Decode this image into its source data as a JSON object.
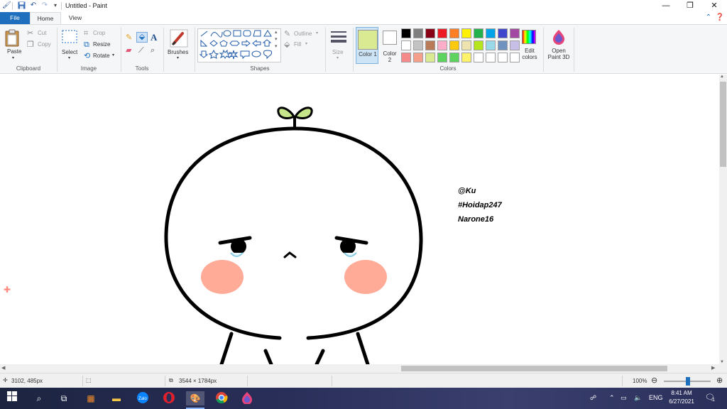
{
  "window": {
    "title": "Untitled - Paint",
    "minimize_glyph": "—",
    "maximize_glyph": "❐",
    "close_glyph": "✕"
  },
  "quick_access": {
    "save_icon": "save-icon",
    "undo_icon": "undo-icon",
    "redo_icon": "redo-icon"
  },
  "tabs": [
    {
      "label": "File"
    },
    {
      "label": "Home"
    },
    {
      "label": "View"
    }
  ],
  "ribbon": {
    "clipboard": {
      "paste": "Paste",
      "cut": "Cut",
      "copy": "Copy",
      "group": "Clipboard"
    },
    "image": {
      "select": "Select",
      "crop": "Crop",
      "resize": "Resize",
      "rotate": "Rotate",
      "group": "Image"
    },
    "tools": {
      "group": "Tools"
    },
    "brushes": {
      "label": "Brushes"
    },
    "shapes": {
      "outline": "Outline",
      "fill": "Fill",
      "group": "Shapes"
    },
    "size": {
      "label": "Size"
    },
    "color1": {
      "label": "Color 1",
      "value": "#d9ea92"
    },
    "color2": {
      "label": "Color 2",
      "value": "#ffffff"
    },
    "colors": {
      "group": "Colors",
      "edit": "Edit colors",
      "palette_row1": [
        "#000000",
        "#7f7f7f",
        "#880015",
        "#ed1c24",
        "#ff7f27",
        "#fff200",
        "#22b14c",
        "#00a2e8",
        "#3f48cc",
        "#a349a4"
      ],
      "palette_row2": [
        "#ffffff",
        "#c3c3c3",
        "#b97a57",
        "#ffaec9",
        "#ffc90e",
        "#efe4b0",
        "#b5e61d",
        "#99d9ea",
        "#7092be",
        "#c8bfe7"
      ],
      "palette_row3": [
        "#f48a8a",
        "#f4a08a",
        "#d9ea92",
        "#5fd35f",
        "#5fd35f",
        "#fff36b",
        "#ffffff",
        "#ffffff",
        "#ffffff",
        "#ffffff"
      ]
    },
    "paint3d": {
      "label": "Open Paint 3D"
    }
  },
  "canvas": {
    "text_lines": [
      "@Ku",
      "#Hoidap247",
      "Narone16"
    ]
  },
  "status": {
    "cursor_pos": "3102, 485px",
    "selection_size": "",
    "image_size": "3544 × 1784px",
    "zoom": "100%",
    "zoom_level_percent": 100
  },
  "taskbar": {
    "lang": "ENG",
    "time": "8:41 AM",
    "date": "6/27/2021",
    "notification_count": "1",
    "apps": [
      "start-icon",
      "search-icon",
      "task-view-icon",
      "app-icon",
      "file-explorer-icon",
      "zalo-icon",
      "opera-icon",
      "paint-icon",
      "chrome-icon",
      "paint3d-icon"
    ]
  },
  "colors": {
    "file_tab": "#1e6fbe",
    "ribbon_bg": "#f5f6f7",
    "cheek": "#ffab97",
    "sprout": "#c6e58b"
  }
}
